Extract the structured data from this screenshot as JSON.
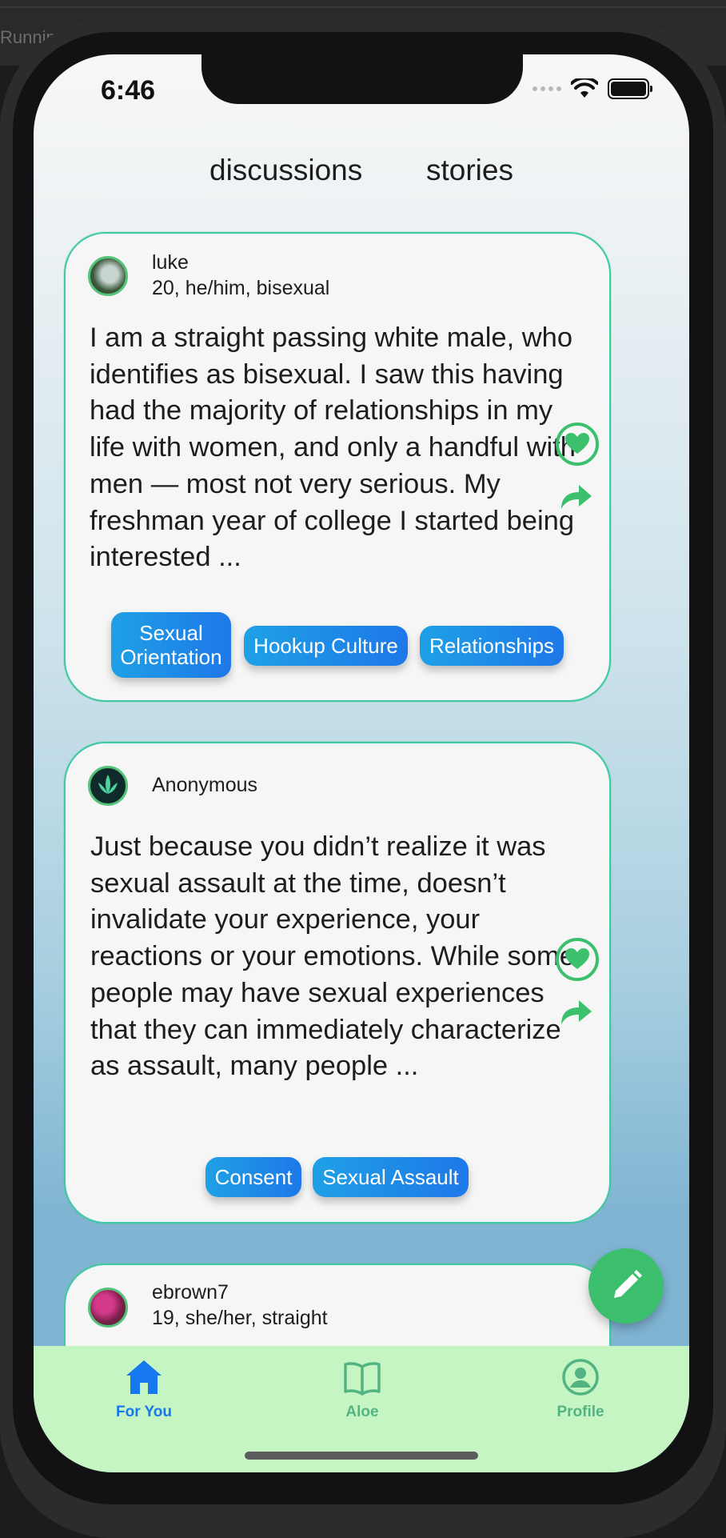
{
  "host": {
    "window_text": "Runnin"
  },
  "status": {
    "time": "6:46"
  },
  "segments": {
    "discussions": "discussions",
    "stories": "stories"
  },
  "posts": [
    {
      "name": "luke",
      "meta": "20, he/him, bisexual",
      "body": "I am a straight passing white male, who identifies as bisexual. I saw this having had the majority of relationships in my life with women, and only a handful with men — most not very serious. My freshman year of college I started being interested ...",
      "tags": [
        "Sexual Orientation",
        "Hookup Culture",
        "Relationships"
      ]
    },
    {
      "name": "Anonymous",
      "meta": "",
      "body": "Just because you didn’t realize it was sexual assault at the time, doesn’t invalidate your experience, your reactions or your emotions. While some people may have sexual experiences that they can immediately characterize as assault, many people ...",
      "tags": [
        "Consent",
        "Sexual Assault"
      ]
    },
    {
      "name": "ebrown7",
      "meta": "19, she/her, straight",
      "body": "",
      "tags": []
    }
  ],
  "tabs": [
    {
      "label": "For You",
      "icon": "home-icon",
      "active": true
    },
    {
      "label": "Aloe",
      "icon": "book-icon",
      "active": false
    },
    {
      "label": "Profile",
      "icon": "profile-icon",
      "active": false
    }
  ],
  "colors": {
    "accent_green": "#3cc06e",
    "tag_blue": "#1e78e8",
    "tab_active": "#1578ef",
    "tabbar_bg": "#c5f5c3"
  }
}
